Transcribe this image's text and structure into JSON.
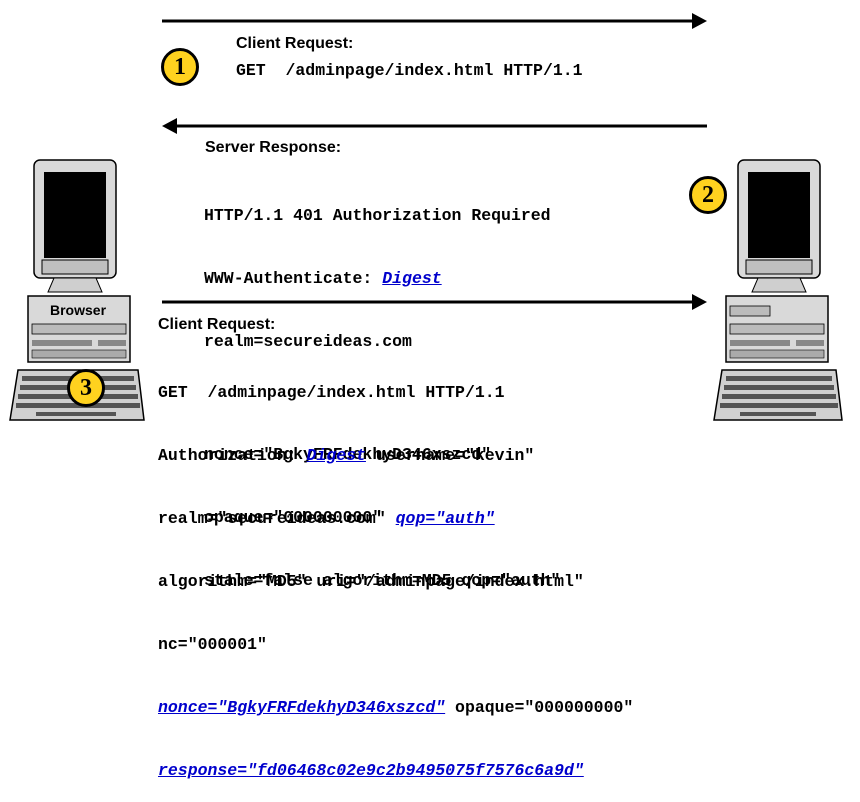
{
  "steps": {
    "one": {
      "number": "1",
      "heading": "Client Request:",
      "line": "GET  /adminpage/index.html HTTP/1.1"
    },
    "two": {
      "number": "2",
      "heading": "Server Response:",
      "line1": "HTTP/1.1 401 Authorization Required",
      "line2_prefix": "WWW-Authenticate: ",
      "line2_link": "Digest",
      "line3": "realm=secureideas.com",
      "line4": "nonce=\"BgkyFRFdekhyD346xszcd\"",
      "line5": "opaque=\"000000000\"",
      "line6": "stale=false algorithm=MD5 qop=\"auth\""
    },
    "three": {
      "number": "3",
      "heading": "Client Request:",
      "line1": "GET  /adminpage/index.html HTTP/1.1",
      "line2_prefix": "Authorization: ",
      "line2_link": "Digest",
      "line2_suffix": " username=\"kevin\"",
      "line3_prefix": "realm=\"secureideas.com\" ",
      "line3_link": "qop=\"auth\"",
      "line4": "algorithm=\"MD5\" uri=\"/adminpage/index.html\"",
      "line5": "nc=\"000001\"",
      "line6_link": "nonce=\"BgkyFRFdekhyD346xszcd\"",
      "line6_suffix": " opaque=\"000000000\"",
      "line7_link": "response=\"fd06468c02e9c2b9495075f7576c6a9d\""
    }
  },
  "client": {
    "label": "Browser"
  },
  "colors": {
    "badge": "#ffd21f",
    "link": "#0000cc",
    "screen": "#000000",
    "case": "#d9d9d9"
  }
}
